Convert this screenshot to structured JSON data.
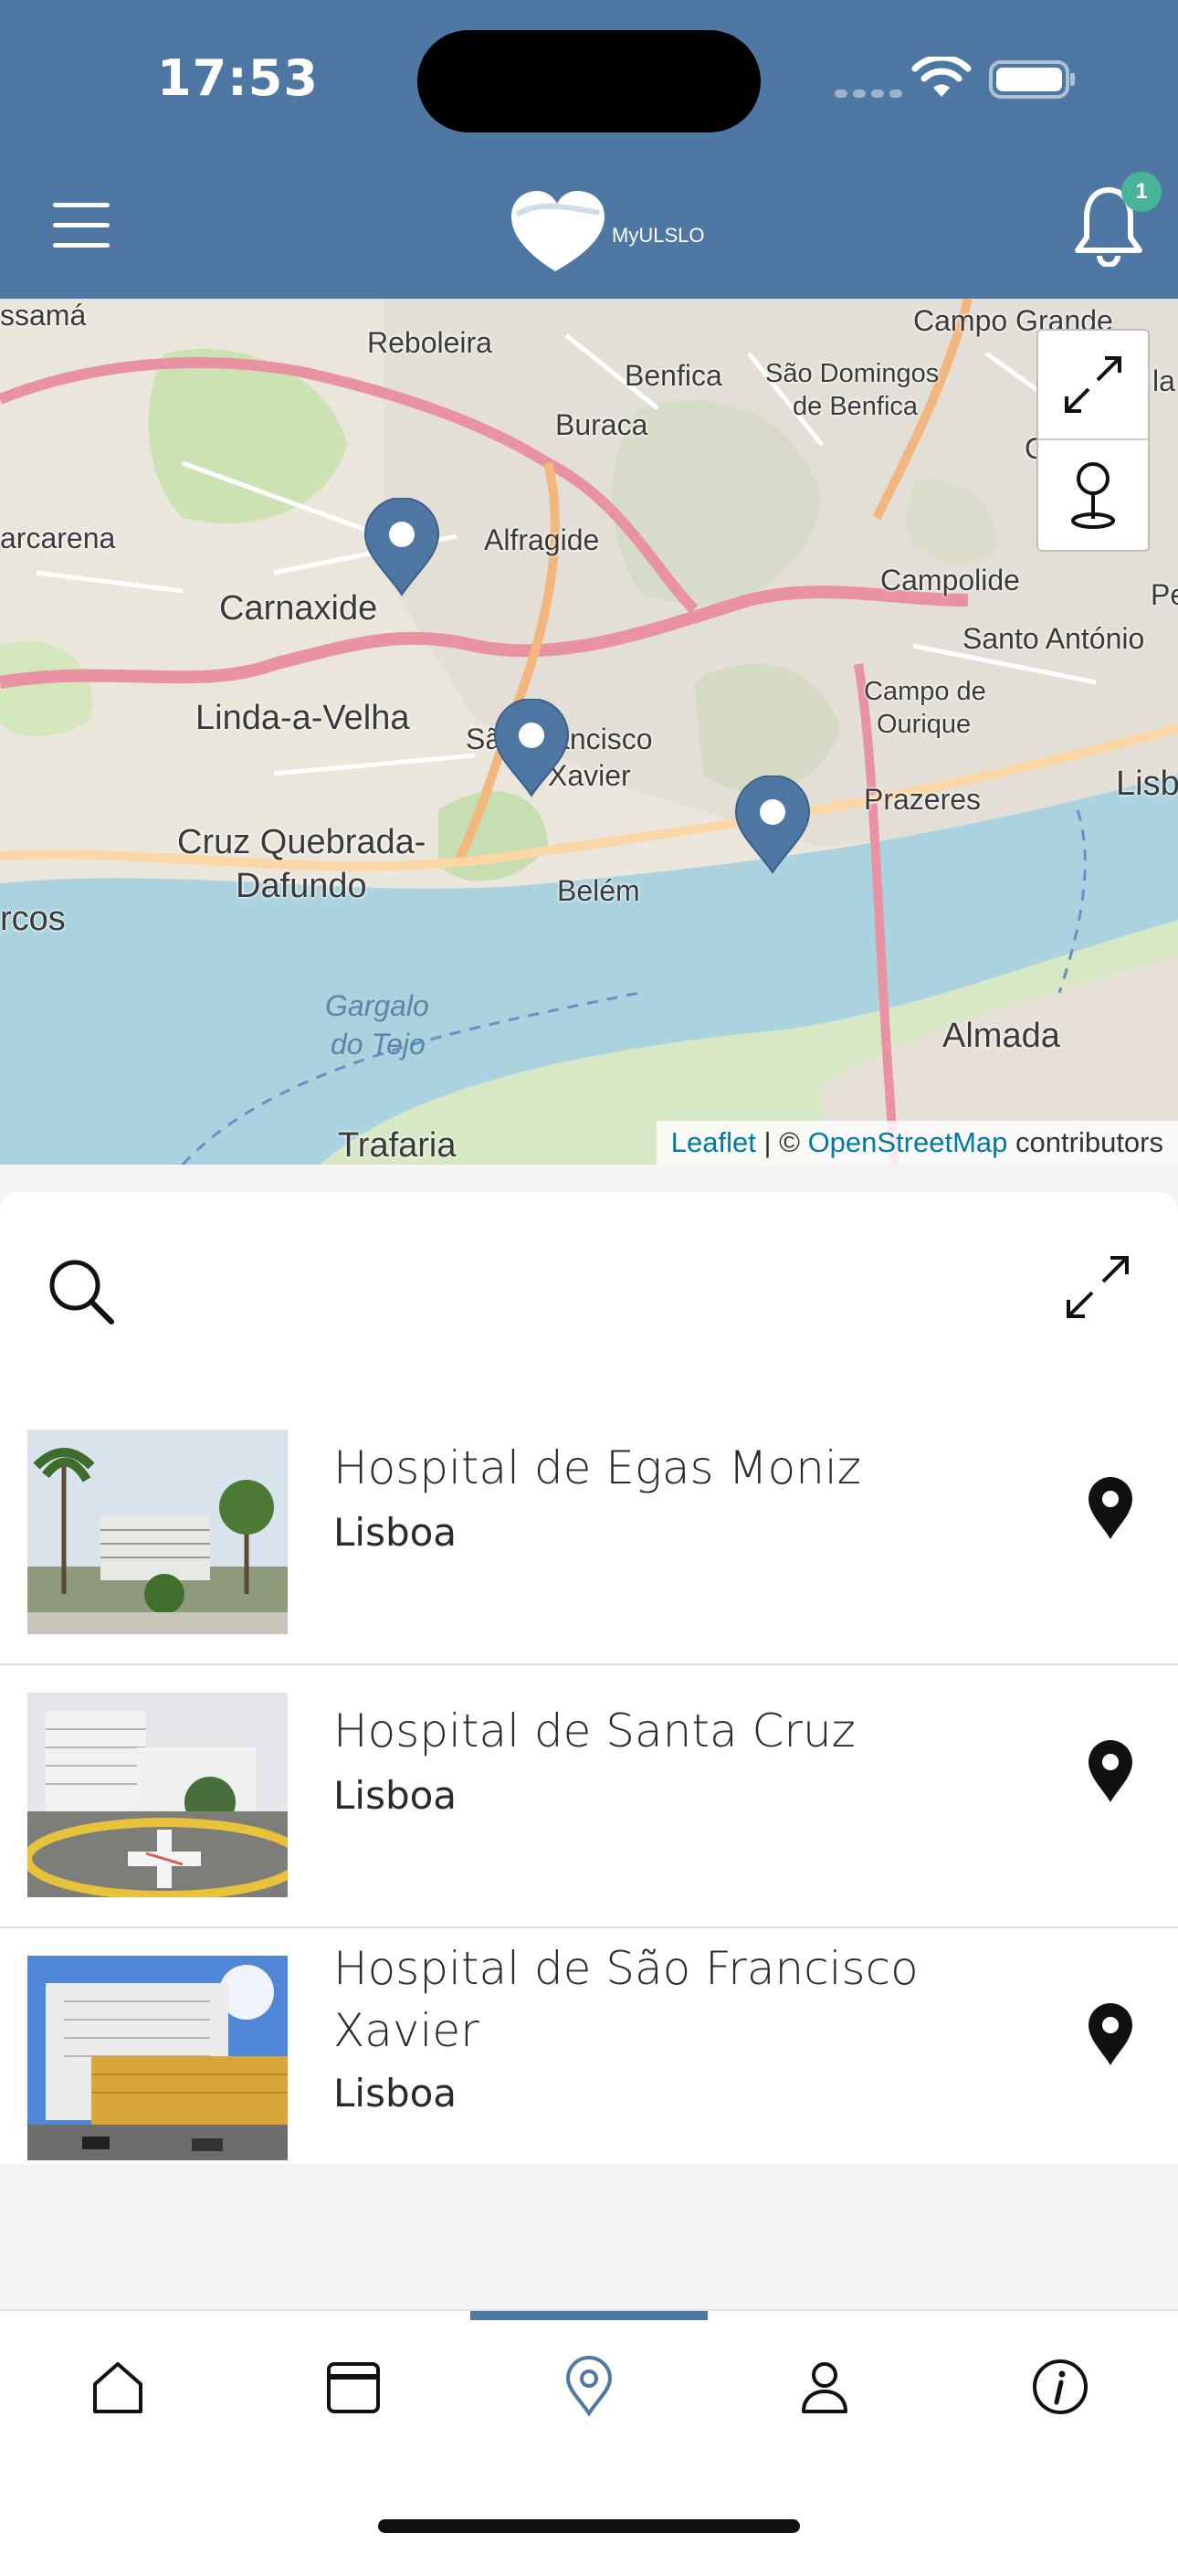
{
  "status_bar": {
    "time": "17:53"
  },
  "header": {
    "logo_text": "MyULSLO",
    "notification_count": "1",
    "accent_color": "#4f77a3",
    "badge_color": "#49b29a"
  },
  "map": {
    "labels": {
      "reboleira": "Reboleira",
      "benfica": "Benfica",
      "sao_domingos_1": "São Domingos",
      "sao_domingos_2": "de Benfica",
      "campo_grande": "Campo Grande",
      "buraca": "Buraca",
      "alfragide": "Alfragide",
      "carnaxide": "Carnaxide",
      "barcarena": "arcarena",
      "campolide": "Campolide",
      "santo_antonio": "Santo António",
      "linda_a_velha": "Linda-a-Velha",
      "sao_francisco_1": "São Francisco",
      "sao_francisco_2": "Xavier",
      "campo_de": "Campo de",
      "ourique": "Ourique",
      "prazeres": "Prazeres",
      "cruz_quebrada_1": "Cruz Quebrada-",
      "cruz_quebrada_2": "Dafundo",
      "belem": "Belém",
      "oeiras": "rcos",
      "gargalo_1": "Gargalo",
      "gargalo_2": "do Tejo",
      "almada": "Almada",
      "trafaria": "Trafaria",
      "lisboa_edge": "Lisb",
      "cam_edge": "Cam",
      "pe_edge": "Pe",
      "la_edge": "la",
      "assama": "ssamá"
    },
    "attribution": {
      "leaflet": "Leaflet",
      "separator": " | © ",
      "osm": "OpenStreetMap",
      "contributors": " contributors"
    },
    "controls": [
      "fullscreen-icon",
      "locate-pin-icon"
    ]
  },
  "list_panel": {
    "hospitals": [
      {
        "name": "Hospital de Egas Moniz",
        "city": "Lisboa"
      },
      {
        "name": "Hospital de Santa Cruz",
        "city": "Lisboa"
      },
      {
        "name": "Hospital de São Francisco",
        "name_line2": "Xavier",
        "city": "Lisboa"
      }
    ]
  },
  "tab_bar": {
    "tabs": [
      "home-icon",
      "calendar-icon",
      "map-pin-icon",
      "user-icon",
      "info-icon"
    ],
    "active_tab": "map-pin-icon"
  }
}
